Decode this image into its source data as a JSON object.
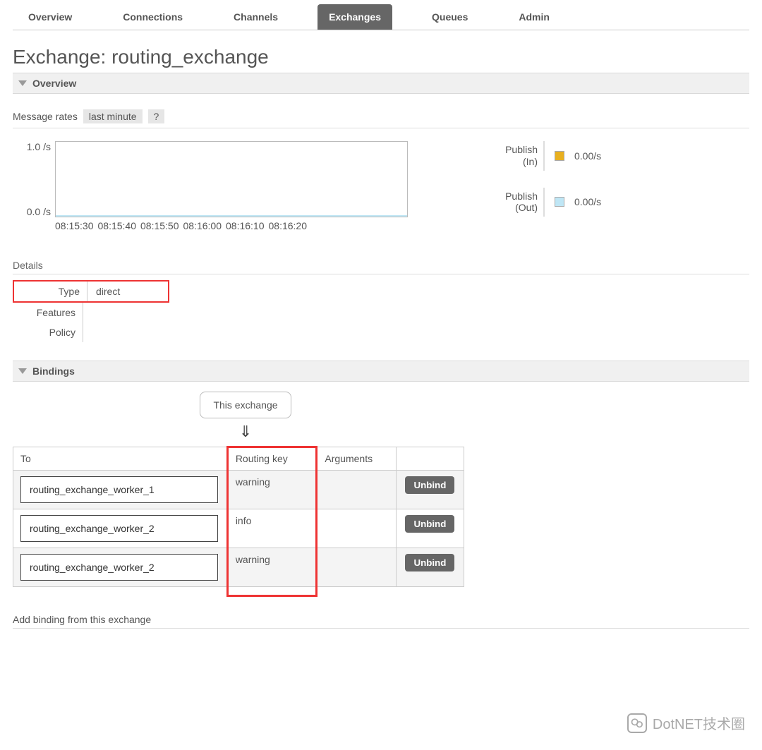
{
  "tabs": {
    "items": [
      {
        "label": "Overview"
      },
      {
        "label": "Connections"
      },
      {
        "label": "Channels"
      },
      {
        "label": "Exchanges"
      },
      {
        "label": "Queues"
      },
      {
        "label": "Admin"
      }
    ],
    "active_index": 3
  },
  "page_title_prefix": "Exchange: ",
  "page_title_name": "routing_exchange",
  "sections": {
    "overview_label": "Overview",
    "bindings_label": "Bindings"
  },
  "message_rates": {
    "label": "Message rates",
    "range_label": "last minute",
    "help_label": "?"
  },
  "chart_data": {
    "type": "line",
    "title": "",
    "xlabel": "",
    "ylabel": "/s",
    "ylim": [
      0.0,
      1.0
    ],
    "yticks": [
      "1.0 /s",
      "0.0 /s"
    ],
    "x": [
      "08:15:30",
      "08:15:40",
      "08:15:50",
      "08:16:00",
      "08:16:10",
      "08:16:20"
    ],
    "series": [
      {
        "name": "Publish (In)",
        "values": [
          0,
          0,
          0,
          0,
          0,
          0
        ],
        "color": "#e8b020",
        "rate_label": "0.00/s"
      },
      {
        "name": "Publish (Out)",
        "values": [
          0,
          0,
          0,
          0,
          0,
          0
        ],
        "color": "#bfe6f5",
        "rate_label": "0.00/s"
      }
    ]
  },
  "details": {
    "header": "Details",
    "rows": {
      "type_label": "Type",
      "type_value": "direct",
      "features_label": "Features",
      "features_value": "",
      "policy_label": "Policy",
      "policy_value": ""
    }
  },
  "bindings": {
    "this_exchange_label": "This exchange",
    "arrow": "⇓",
    "headers": {
      "to": "To",
      "routing_key": "Routing key",
      "arguments": "Arguments",
      "actions": ""
    },
    "rows": [
      {
        "to": "routing_exchange_worker_1",
        "routing_key": "warning",
        "arguments": "",
        "unbind_label": "Unbind"
      },
      {
        "to": "routing_exchange_worker_2",
        "routing_key": "info",
        "arguments": "",
        "unbind_label": "Unbind"
      },
      {
        "to": "routing_exchange_worker_2",
        "routing_key": "warning",
        "arguments": "",
        "unbind_label": "Unbind"
      }
    ]
  },
  "add_binding_header": "Add binding from this exchange",
  "watermark": {
    "text": "DotNET技术圈"
  },
  "legend_labels": {
    "publish_in_a": "Publish",
    "publish_in_b": "(In)",
    "publish_out_a": "Publish",
    "publish_out_b": "(Out)"
  }
}
